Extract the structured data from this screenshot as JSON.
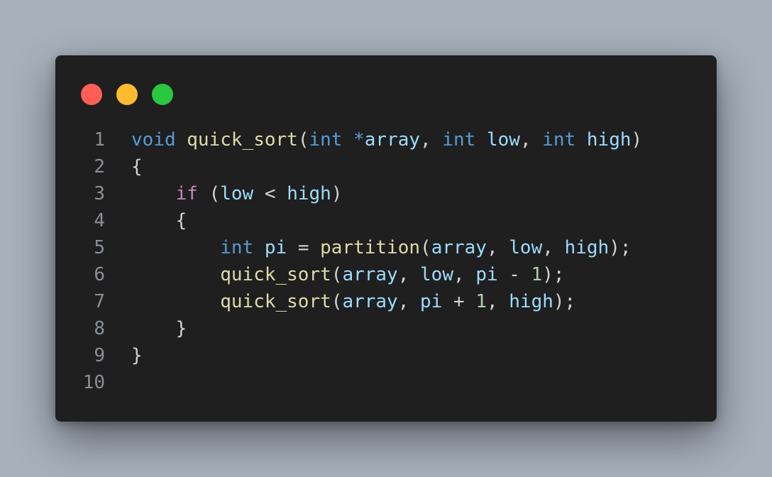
{
  "window": {
    "buttons": [
      {
        "name": "close",
        "color": "#ff5f57"
      },
      {
        "name": "minimize",
        "color": "#febc2e"
      },
      {
        "name": "maximize",
        "color": "#28c840"
      }
    ]
  },
  "colors": {
    "keyword": "#569cd6",
    "control": "#c586c0",
    "function": "#dcdcaa",
    "variable": "#9cdcfe",
    "number": "#b5cea8",
    "punctuation": "#d4d4d4",
    "line_number": "#8a8f95",
    "background": "#1f1f1f"
  },
  "code": {
    "lines": [
      {
        "number": "1",
        "tokens": [
          {
            "t": "void",
            "c": "kw"
          },
          {
            "t": " ",
            "c": "punc"
          },
          {
            "t": "quick_sort",
            "c": "fn"
          },
          {
            "t": "(",
            "c": "punc"
          },
          {
            "t": "int",
            "c": "kw"
          },
          {
            "t": " ",
            "c": "punc"
          },
          {
            "t": "*",
            "c": "kw"
          },
          {
            "t": "array",
            "c": "var"
          },
          {
            "t": ", ",
            "c": "punc"
          },
          {
            "t": "int",
            "c": "kw"
          },
          {
            "t": " ",
            "c": "punc"
          },
          {
            "t": "low",
            "c": "var"
          },
          {
            "t": ", ",
            "c": "punc"
          },
          {
            "t": "int",
            "c": "kw"
          },
          {
            "t": " ",
            "c": "punc"
          },
          {
            "t": "high",
            "c": "var"
          },
          {
            "t": ")",
            "c": "punc"
          }
        ]
      },
      {
        "number": "2",
        "tokens": [
          {
            "t": "{",
            "c": "punc"
          }
        ]
      },
      {
        "number": "3",
        "tokens": [
          {
            "t": "    ",
            "c": "punc"
          },
          {
            "t": "if",
            "c": "ctrl"
          },
          {
            "t": " (",
            "c": "punc"
          },
          {
            "t": "low",
            "c": "var"
          },
          {
            "t": " < ",
            "c": "punc"
          },
          {
            "t": "high",
            "c": "var"
          },
          {
            "t": ")",
            "c": "punc"
          }
        ]
      },
      {
        "number": "4",
        "tokens": [
          {
            "t": "    {",
            "c": "punc"
          }
        ]
      },
      {
        "number": "5",
        "tokens": [
          {
            "t": "        ",
            "c": "punc"
          },
          {
            "t": "int",
            "c": "kw"
          },
          {
            "t": " ",
            "c": "punc"
          },
          {
            "t": "pi",
            "c": "var"
          },
          {
            "t": " = ",
            "c": "punc"
          },
          {
            "t": "partition",
            "c": "fn"
          },
          {
            "t": "(",
            "c": "punc"
          },
          {
            "t": "array",
            "c": "var"
          },
          {
            "t": ", ",
            "c": "punc"
          },
          {
            "t": "low",
            "c": "var"
          },
          {
            "t": ", ",
            "c": "punc"
          },
          {
            "t": "high",
            "c": "var"
          },
          {
            "t": ");",
            "c": "punc"
          }
        ]
      },
      {
        "number": "6",
        "tokens": [
          {
            "t": "        ",
            "c": "punc"
          },
          {
            "t": "quick_sort",
            "c": "fn"
          },
          {
            "t": "(",
            "c": "punc"
          },
          {
            "t": "array",
            "c": "var"
          },
          {
            "t": ", ",
            "c": "punc"
          },
          {
            "t": "low",
            "c": "var"
          },
          {
            "t": ", ",
            "c": "punc"
          },
          {
            "t": "pi",
            "c": "var"
          },
          {
            "t": " - ",
            "c": "punc"
          },
          {
            "t": "1",
            "c": "num"
          },
          {
            "t": ");",
            "c": "punc"
          }
        ]
      },
      {
        "number": "7",
        "tokens": [
          {
            "t": "        ",
            "c": "punc"
          },
          {
            "t": "quick_sort",
            "c": "fn"
          },
          {
            "t": "(",
            "c": "punc"
          },
          {
            "t": "array",
            "c": "var"
          },
          {
            "t": ", ",
            "c": "punc"
          },
          {
            "t": "pi",
            "c": "var"
          },
          {
            "t": " + ",
            "c": "punc"
          },
          {
            "t": "1",
            "c": "num"
          },
          {
            "t": ", ",
            "c": "punc"
          },
          {
            "t": "high",
            "c": "var"
          },
          {
            "t": ");",
            "c": "punc"
          }
        ]
      },
      {
        "number": "8",
        "tokens": [
          {
            "t": "    }",
            "c": "punc"
          }
        ]
      },
      {
        "number": "9",
        "tokens": [
          {
            "t": "}",
            "c": "punc"
          }
        ]
      },
      {
        "number": "10",
        "tokens": []
      }
    ]
  }
}
